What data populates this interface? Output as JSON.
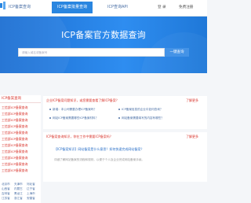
{
  "nav": {
    "items": [
      {
        "label": "ICP备案查询"
      },
      {
        "label": "ICP备案批量查询"
      },
      {
        "label": "ICP查询API"
      }
    ],
    "login": "登 录",
    "register": "免费注册"
  },
  "hero": {
    "title": "ICP备案官方数据查询",
    "placeholder": "请输入域名或备案号",
    "button": "一键查询"
  },
  "sidebar": {
    "header": "ICP备案查询",
    "links": [
      "工信部ICP备案查询",
      "工信部ICP备案查询",
      "工信部ICP备案查询",
      "工信部ICP备案查询",
      "工信部ICP备案查询",
      "工信部ICP备案查询",
      "工信部ICP备案查询",
      "工信部ICP备案查询",
      "工信部ICP备案查询",
      "工信部ICP备案查询",
      "工信部ICP备案查询"
    ],
    "bottom_links": [
      "北京市",
      "天津市",
      "河北省",
      "山西省",
      "内蒙古",
      "辽宁省",
      "吉林省",
      "黑龙江",
      "上海市",
      "江苏省",
      "浙江省",
      "安徽省",
      "福建省",
      "江西省",
      "山东省"
    ]
  },
  "faq": {
    "header": "企业ICP备案问题知识，或您需要查看了解ICP备案？",
    "more": "了解更多",
    "questions": [
      "新增：本公司需要办理ICP备案吗？",
      "ICP备案信息的企业中如何查询？",
      "网站ICP备案需要哪些ICP备案材料？",
      "网站备案需要填写的内容有哪些？"
    ]
  },
  "news": {
    "header": "ICP备案查询知识，你在工作中需要ICP备案吗？",
    "more": "了解更多",
    "article_title": "【ICP备案知识】网站备案是什么意思？如何快速完成网站备案？",
    "article_desc": "详细了解网站备案的流程和规则，以便于个人及企业完成网站备案手续。"
  }
}
